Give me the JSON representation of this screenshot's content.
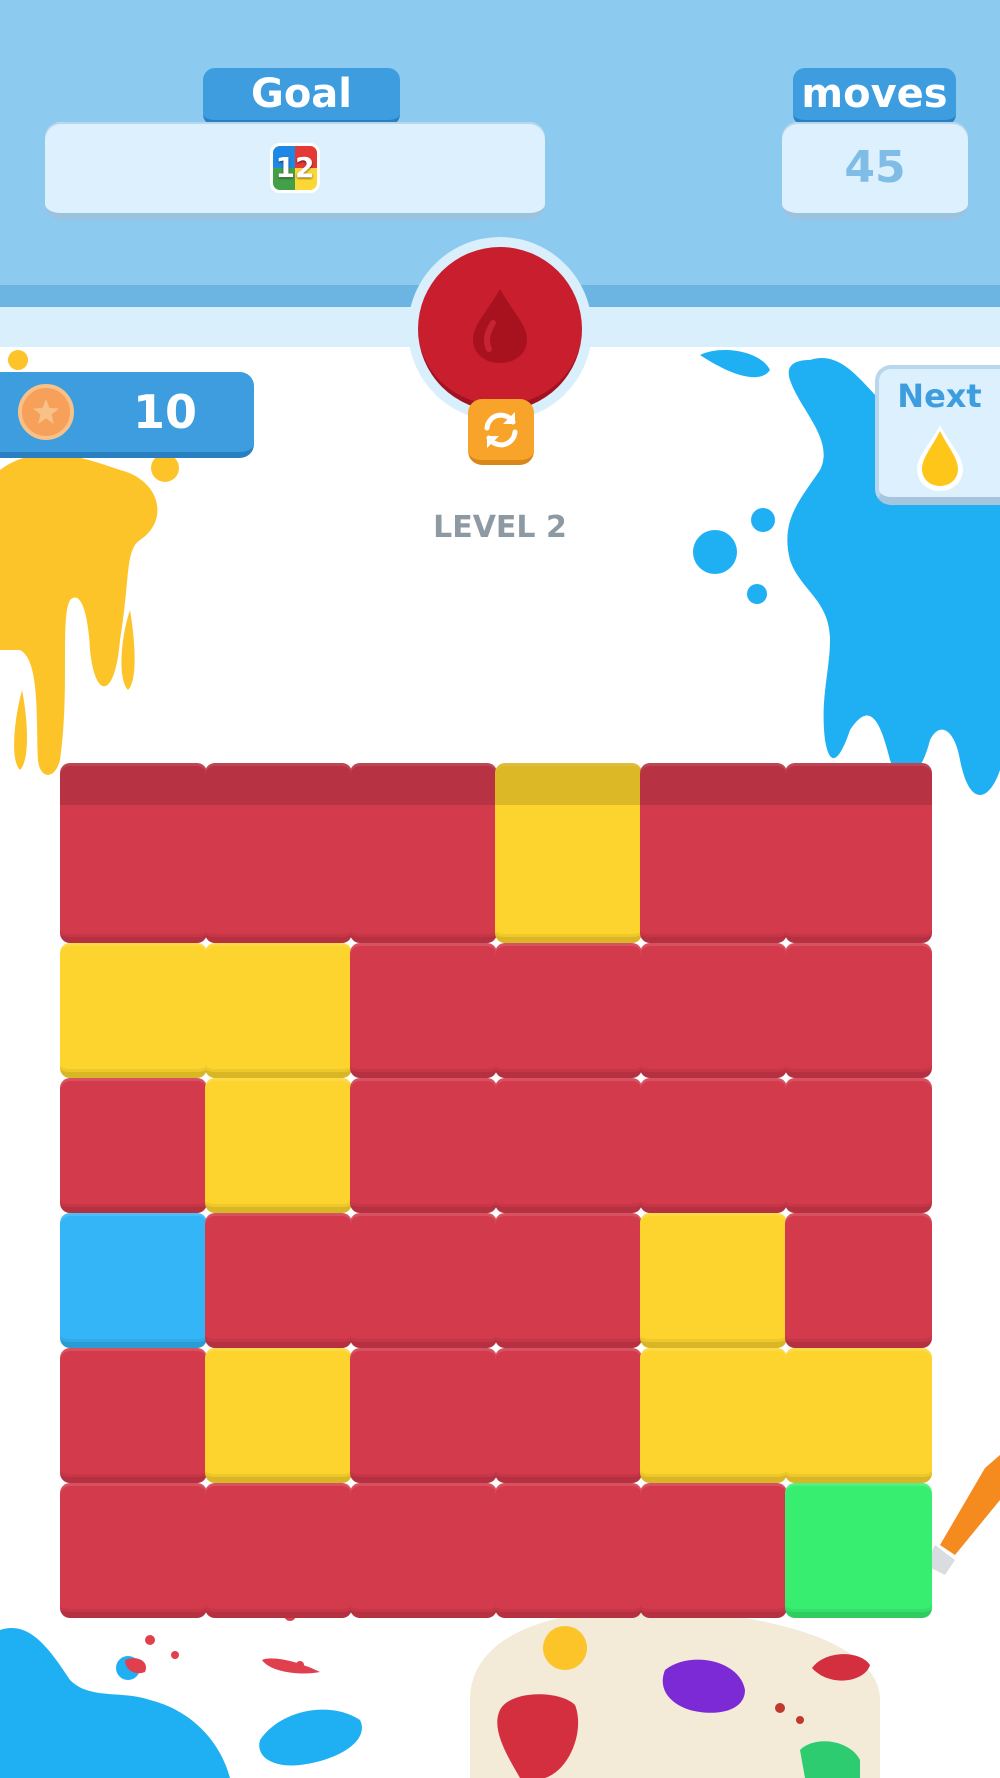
{
  "colors": {
    "red": "#d33a4c",
    "yellow": "#fdd42d",
    "blue": "#33b5f7",
    "green": "#38ee70",
    "header": "#8ccaf0",
    "accent": "#3d9ddf",
    "paint": "#c81e2d",
    "next_drop": "#ffc61a"
  },
  "header": {
    "goal_label": "Goal",
    "goal_value": "12",
    "moves_label": "moves",
    "moves_value": "45"
  },
  "paint_button": {
    "icon": "drop-icon",
    "color": "red"
  },
  "swap_button": {
    "icon": "swap-icon"
  },
  "coins": {
    "icon": "coin-star-icon",
    "value": "10"
  },
  "next": {
    "label": "Next",
    "color": "yellow",
    "icon": "drop-icon"
  },
  "level": {
    "label": "LEVEL 2"
  },
  "board": {
    "rows": [
      [
        "red",
        "red",
        "red",
        "yellow",
        "red",
        "red"
      ],
      [
        "yellow",
        "yellow",
        "red",
        "red",
        "red",
        "red"
      ],
      [
        "red",
        "yellow",
        "red",
        "red",
        "red",
        "red"
      ],
      [
        "blue",
        "red",
        "red",
        "red",
        "yellow",
        "red"
      ],
      [
        "red",
        "yellow",
        "red",
        "red",
        "yellow",
        "yellow"
      ],
      [
        "red",
        "red",
        "red",
        "red",
        "red",
        "green"
      ]
    ]
  }
}
